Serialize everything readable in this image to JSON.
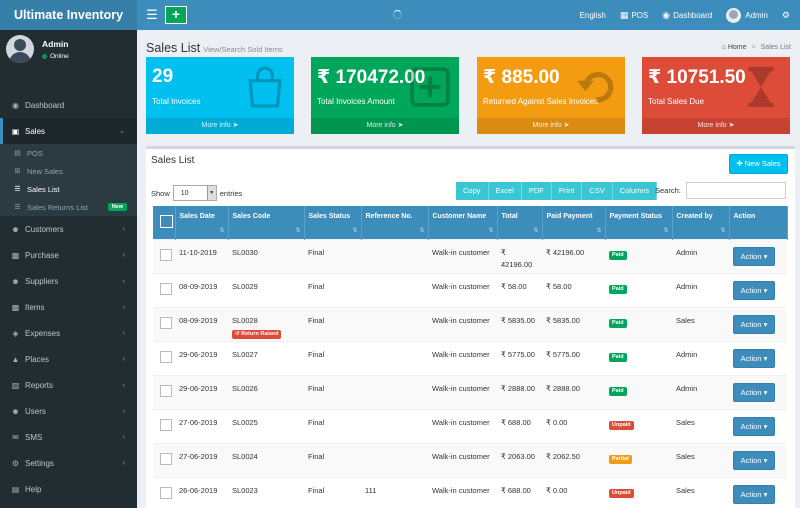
{
  "app": {
    "brand": "Ultimate Inventory"
  },
  "navbar": {
    "language": "English",
    "pos": "POS",
    "dashboard": "Dashboard",
    "user": "Admin"
  },
  "sidebar": {
    "user": {
      "name": "Admin",
      "status": "Online"
    },
    "items": {
      "dashboard": "Dashboard",
      "sales": "Sales",
      "customers": "Customers",
      "purchase": "Purchase",
      "suppliers": "Suppliers",
      "items": "Items",
      "expenses": "Expenses",
      "places": "Places",
      "reports": "Reports",
      "users": "Users",
      "sms": "SMS",
      "settings": "Settings",
      "help": "Help"
    },
    "sales_sub": {
      "pos": "POS",
      "new_sales": "New Sales",
      "sales_list": "Sales List",
      "sales_returns": "Sales Returns List",
      "new_badge": "New"
    }
  },
  "page": {
    "title": "Sales List",
    "subtitle": "View/Search Sold Items",
    "breadcrumb": {
      "home": "Home",
      "current": "Sales List"
    }
  },
  "stats": [
    {
      "value": "29",
      "label": "Total Invoices",
      "more": "More info",
      "color": "#00c0ef"
    },
    {
      "value": "₹ 170472.00",
      "label": "Total Invoices Amount",
      "more": "More info",
      "color": "#00a65a"
    },
    {
      "value": "₹ 885.00",
      "label": "Returned Against Sales Invoices",
      "more": "More info",
      "color": "#f39c12"
    },
    {
      "value": "₹ 10751.50",
      "label": "Total Sales Due",
      "more": "More info",
      "color": "#dd4b39"
    }
  ],
  "panel": {
    "title": "Sales List",
    "new_sales_label": "New Sales",
    "show_label": "Show",
    "entries_value": "10",
    "entries_label": "entries",
    "search_label": "Search:",
    "export_buttons": [
      "Copy",
      "Excel",
      "PDF",
      "Print",
      "CSV",
      "Columns"
    ]
  },
  "table": {
    "headers": [
      "",
      "Sales Date",
      "Sales Code",
      "Sales Status",
      "Reference No.",
      "Customer Name",
      "Total",
      "Paid Payment",
      "Payment Status",
      "Created by",
      "Action"
    ],
    "rows": [
      {
        "date": "11-10-2019",
        "code": "SL0030",
        "returned": "",
        "status": "Final",
        "ref": "",
        "customer": "Walk-in customer",
        "total": "₹ 42196.00",
        "paid": "₹ 42196.00",
        "payment": "Paid",
        "created": "Admin",
        "action": "Action"
      },
      {
        "date": "08-09-2019",
        "code": "SL0029",
        "returned": "",
        "status": "Final",
        "ref": "",
        "customer": "Walk-in customer",
        "total": "₹ 58.00",
        "paid": "₹ 58.00",
        "payment": "Paid",
        "created": "Admin",
        "action": "Action"
      },
      {
        "date": "08-09-2019",
        "code": "SL0028",
        "returned": "Return Raised",
        "status": "Final",
        "ref": "",
        "customer": "Walk-in customer",
        "total": "₹ 5835.00",
        "paid": "₹ 5835.00",
        "payment": "Paid",
        "created": "Sales",
        "action": "Action"
      },
      {
        "date": "29-06-2019",
        "code": "SL0027",
        "returned": "",
        "status": "Final",
        "ref": "",
        "customer": "Walk-in customer",
        "total": "₹ 5775.00",
        "paid": "₹ 5775.00",
        "payment": "Paid",
        "created": "Admin",
        "action": "Action"
      },
      {
        "date": "29-06-2019",
        "code": "SL0026",
        "returned": "",
        "status": "Final",
        "ref": "",
        "customer": "Walk-in customer",
        "total": "₹ 2888.00",
        "paid": "₹ 2888.00",
        "payment": "Paid",
        "created": "Admin",
        "action": "Action"
      },
      {
        "date": "27-06-2019",
        "code": "SL0025",
        "returned": "",
        "status": "Final",
        "ref": "",
        "customer": "Walk-in customer",
        "total": "₹ 688.00",
        "paid": "₹ 0.00",
        "payment": "Unpaid",
        "created": "Sales",
        "action": "Action"
      },
      {
        "date": "27-06-2019",
        "code": "SL0024",
        "returned": "",
        "status": "Final",
        "ref": "",
        "customer": "Walk-in customer",
        "total": "₹ 2063.00",
        "paid": "₹ 2062.50",
        "payment": "Partial",
        "created": "Sales",
        "action": "Action"
      },
      {
        "date": "26-06-2019",
        "code": "SL0023",
        "returned": "",
        "status": "Final",
        "ref": "111",
        "customer": "Walk-in customer",
        "total": "₹ 688.00",
        "paid": "₹ 0.00",
        "payment": "Unpaid",
        "created": "Sales",
        "action": "Action"
      }
    ]
  },
  "colors": {
    "paid": "#00a65a",
    "unpaid": "#dd4b39",
    "partial": "#f39c12",
    "primary": "#3c8dbc"
  }
}
